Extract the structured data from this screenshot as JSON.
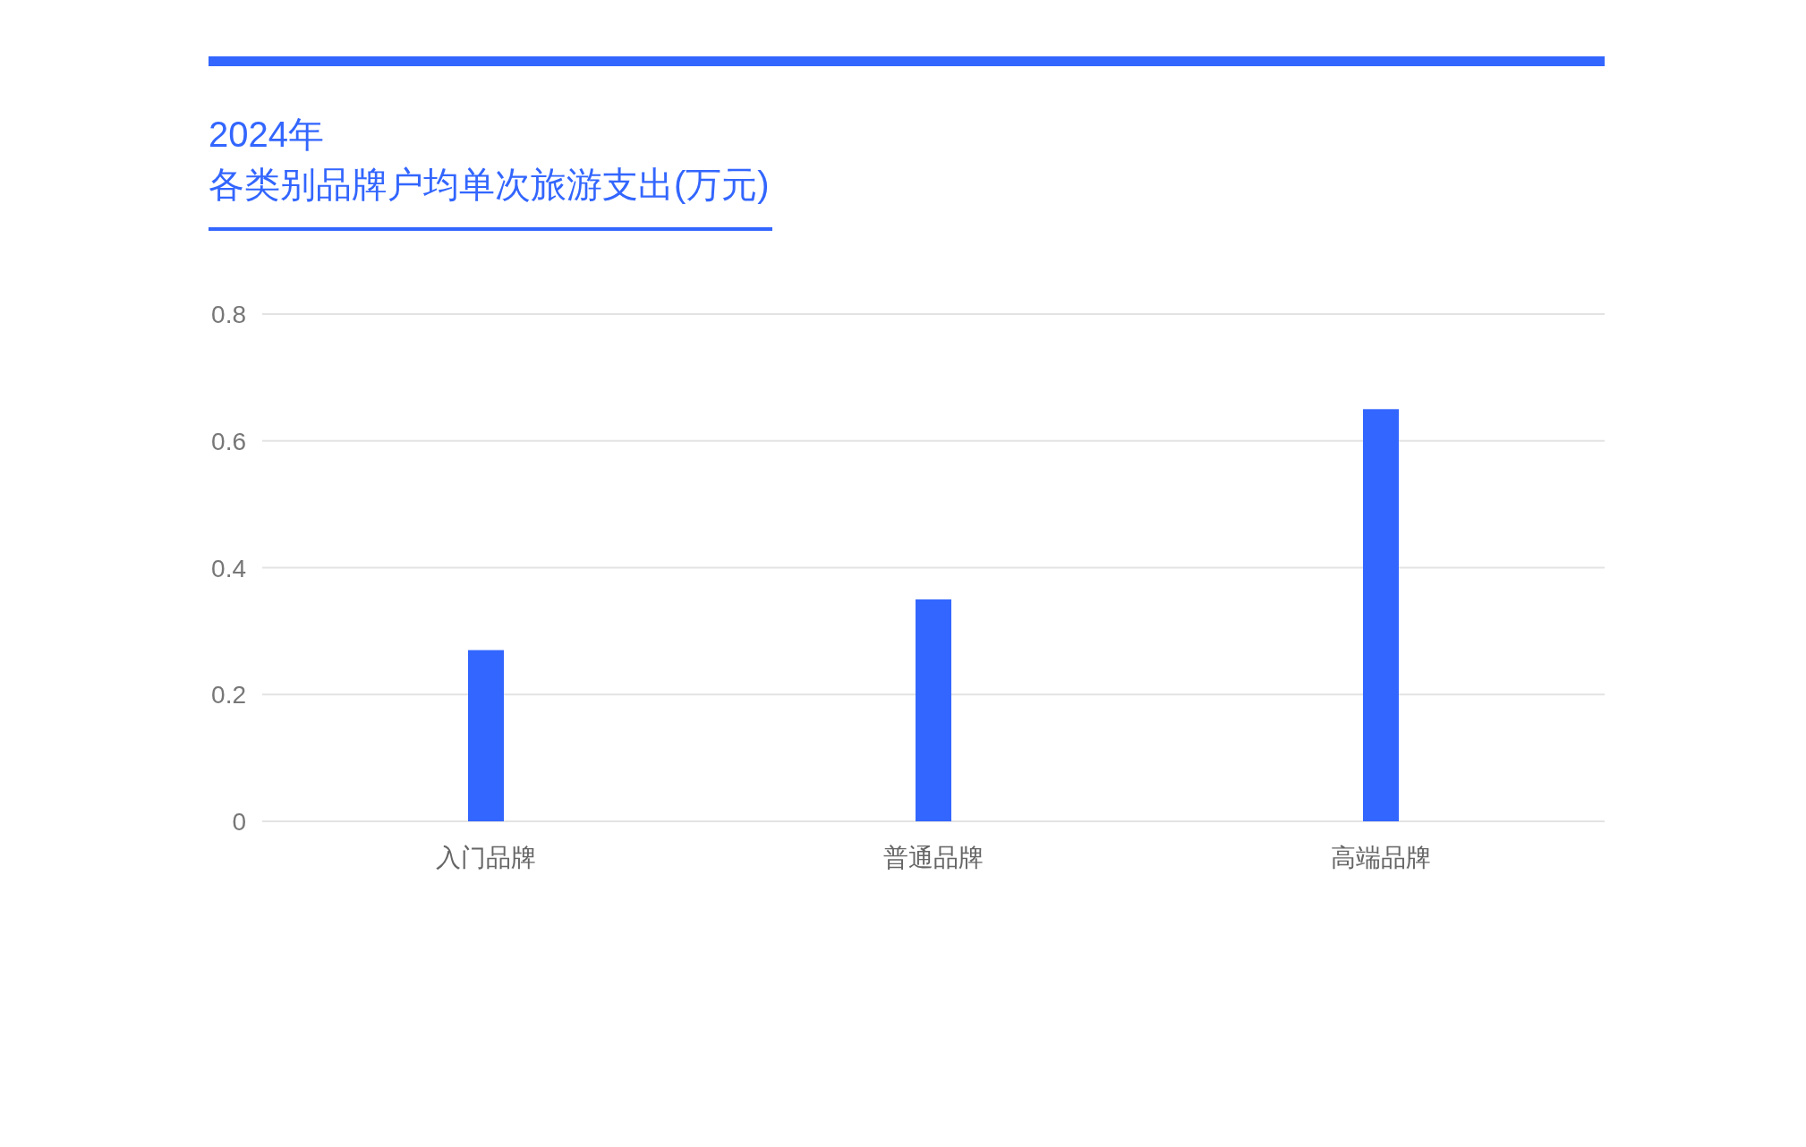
{
  "title": {
    "year": "2024年",
    "subtitle": "各类别品牌户均单次旅游支出(万元)"
  },
  "chart_data": {
    "type": "bar",
    "categories": [
      "入门品牌",
      "普通品牌",
      "高端品牌"
    ],
    "values": [
      0.27,
      0.35,
      0.65
    ],
    "ylim": [
      0,
      0.8
    ],
    "yticks": [
      0,
      0.2,
      0.4,
      0.6,
      0.8
    ],
    "grid": true
  }
}
